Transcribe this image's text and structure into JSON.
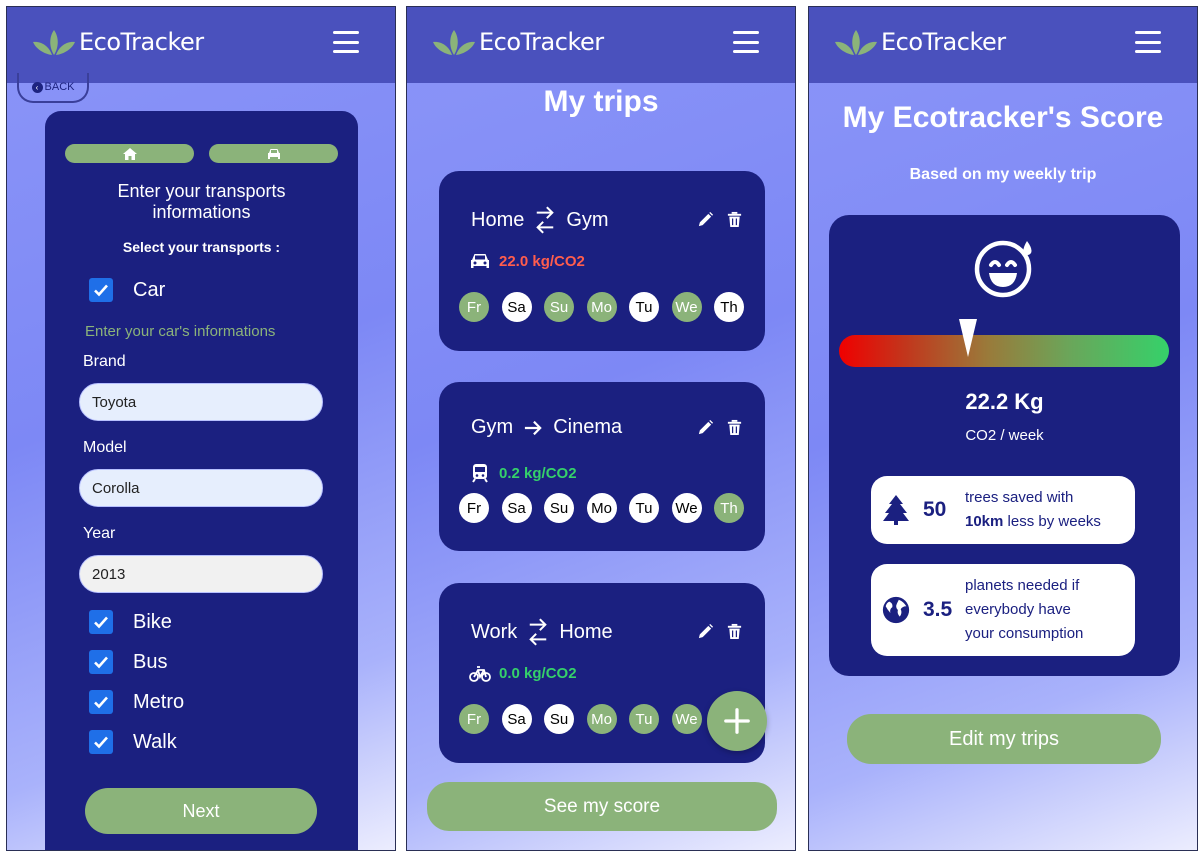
{
  "app": {
    "name": "EcoTracker"
  },
  "colors": {
    "primary": "#1b2080",
    "topbar": "#4a51bd",
    "green": "#8bb37a",
    "red": "#ff5d4d",
    "lime": "#35d16a"
  },
  "screen1": {
    "back_label": "BACK",
    "title": "Enter your transports informations",
    "subtitle": "Select your transports :",
    "car_label": "Car",
    "car_info_hint": "Enter your car's informations",
    "brand_label": "Brand",
    "brand_value": "Toyota",
    "model_label": "Model",
    "model_value": "Corolla",
    "year_label": "Year",
    "year_value": "2013",
    "other_transports": [
      "Bike",
      "Bus",
      "Metro",
      "Walk"
    ],
    "next_label": "Next"
  },
  "screen2": {
    "title": "My trips",
    "trips": [
      {
        "from": "Home",
        "to": "Gym",
        "roundtrip": true,
        "co2": "22.0 kg/CO2",
        "co2_color": "#ff5d4d",
        "vehicle": "car-icon",
        "days": [
          {
            "l": "Fr",
            "on": true
          },
          {
            "l": "Sa",
            "on": false
          },
          {
            "l": "Su",
            "on": true
          },
          {
            "l": "Mo",
            "on": true
          },
          {
            "l": "Tu",
            "on": false
          },
          {
            "l": "We",
            "on": true
          },
          {
            "l": "Th",
            "on": false
          }
        ]
      },
      {
        "from": "Gym",
        "to": "Cinema",
        "roundtrip": false,
        "co2": "0.2 kg/CO2",
        "co2_color": "#35d16a",
        "vehicle": "train-icon",
        "days": [
          {
            "l": "Fr",
            "on": false
          },
          {
            "l": "Sa",
            "on": false
          },
          {
            "l": "Su",
            "on": false
          },
          {
            "l": "Mo",
            "on": false
          },
          {
            "l": "Tu",
            "on": false
          },
          {
            "l": "We",
            "on": false
          },
          {
            "l": "Th",
            "on": true
          }
        ]
      },
      {
        "from": "Work",
        "to": "Home",
        "roundtrip": true,
        "co2": "0.0 kg/CO2",
        "co2_color": "#35d16a",
        "vehicle": "bike-icon",
        "days": [
          {
            "l": "Fr",
            "on": true
          },
          {
            "l": "Sa",
            "on": false
          },
          {
            "l": "Su",
            "on": false
          },
          {
            "l": "Mo",
            "on": true
          },
          {
            "l": "Tu",
            "on": true
          },
          {
            "l": "We",
            "on": true
          }
        ]
      }
    ],
    "add_label": "+",
    "see_score_label": "See my score"
  },
  "screen3": {
    "title": "My Ecotracker's Score",
    "subtitle": "Based on my weekly trip",
    "gauge_level": 0.39,
    "score_value": "22.2 Kg",
    "score_unit": "CO2 / week",
    "trees_count": "50",
    "trees_text_1": "trees saved with",
    "trees_bold": "10km",
    "trees_text_2": "less by weeks",
    "planets_count": "3.5",
    "planets_text_1": "planets needed if",
    "planets_text_2": "everybody have",
    "planets_text_3": "your consumption",
    "edit_label": "Edit my trips"
  }
}
